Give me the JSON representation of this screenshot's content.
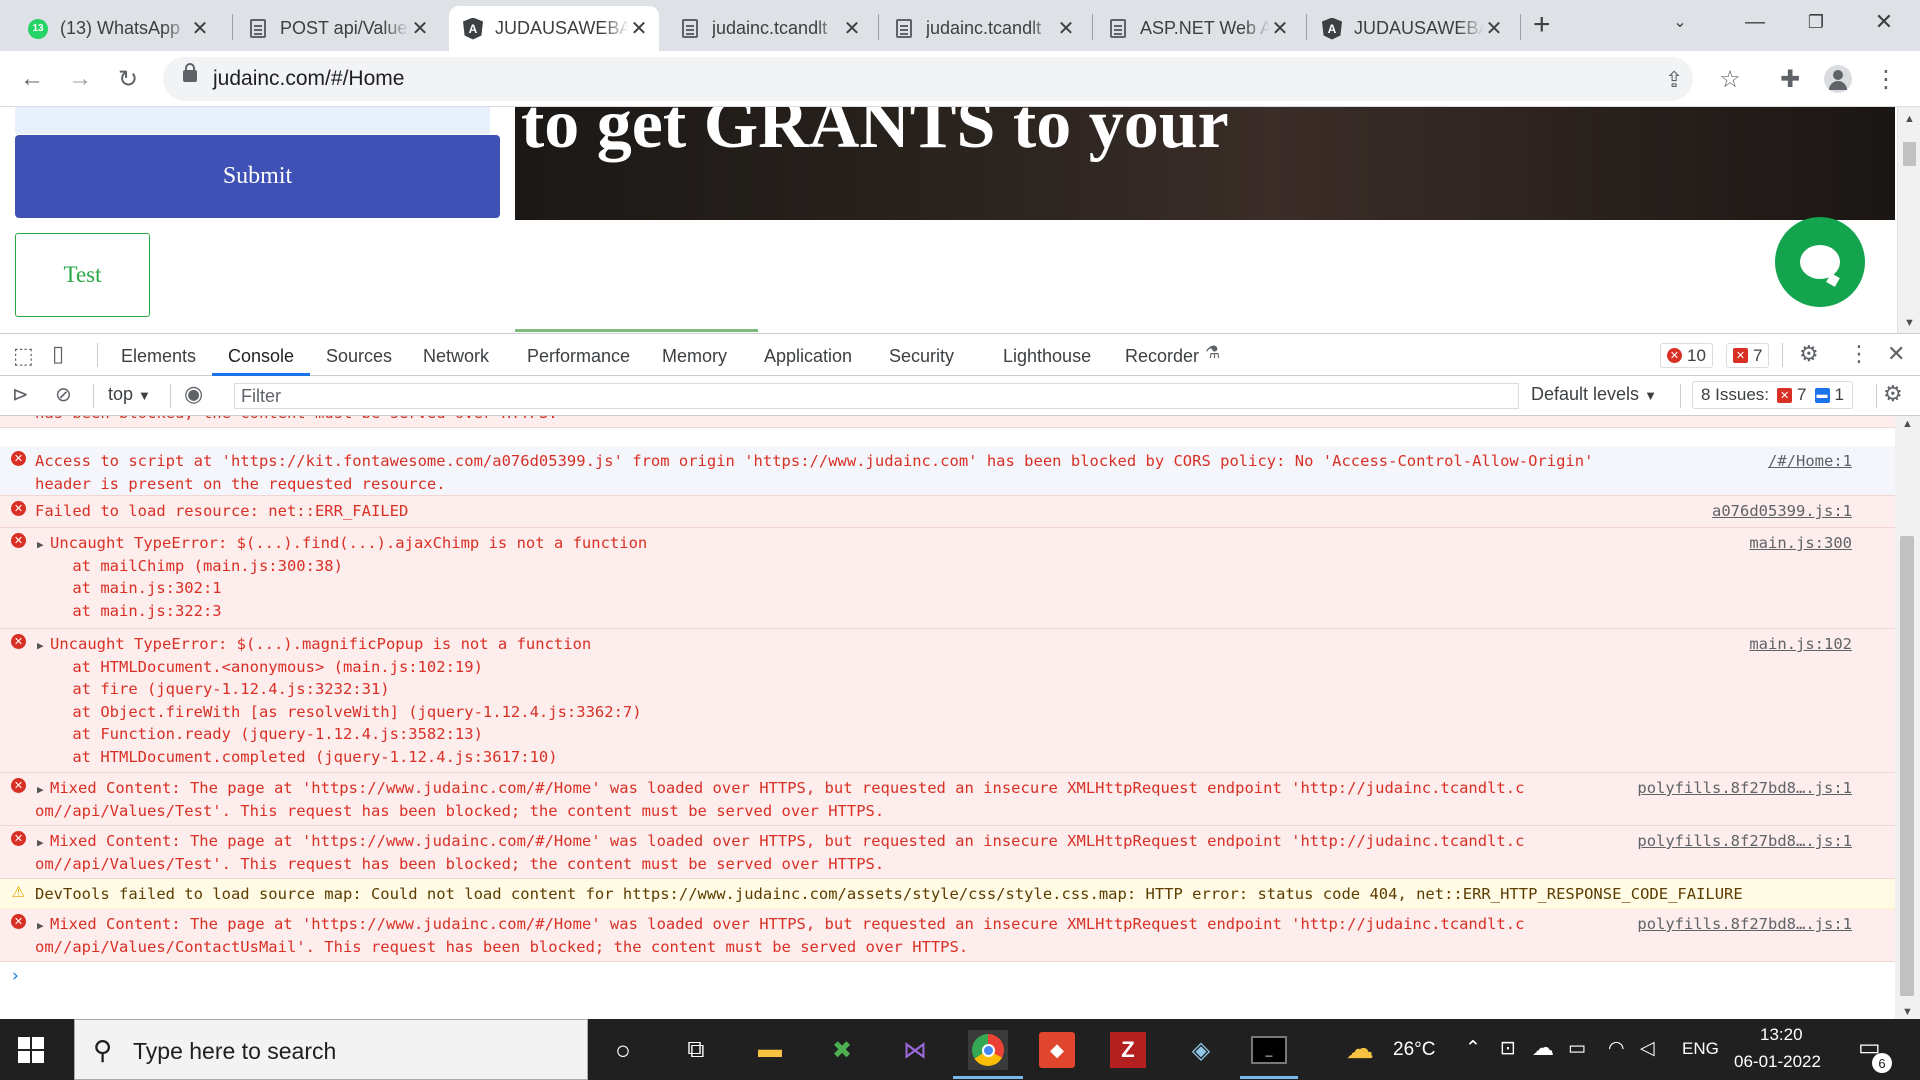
{
  "tabs": [
    {
      "title": "(13) WhatsApp",
      "icon": "whatsapp-icon",
      "badge": "13"
    },
    {
      "title": "POST api/Values",
      "icon": "document-icon"
    },
    {
      "title": "JUDAUSAWEBAPP",
      "icon": "angular-icon",
      "active": true
    },
    {
      "title": "judainc.tcandlt",
      "icon": "document-icon"
    },
    {
      "title": "judainc.tcandlt",
      "icon": "document-icon"
    },
    {
      "title": "ASP.NET Web API",
      "icon": "document-icon"
    },
    {
      "title": "JUDAUSAWEBAPP",
      "icon": "angular-icon"
    }
  ],
  "address_bar": {
    "url": "judainc.com/#/Home"
  },
  "page": {
    "submit_label": "Submit",
    "test_label": "Test",
    "hero_text": "to get GRANTS to your"
  },
  "devtools": {
    "tabs": [
      "Elements",
      "Console",
      "Sources",
      "Network",
      "Performance",
      "Memory",
      "Application",
      "Security",
      "Lighthouse",
      "Recorder"
    ],
    "active_tab": "Console",
    "error_count": "10",
    "issue_count": "7",
    "context": "top",
    "filter_placeholder": "Filter",
    "levels": "Default levels",
    "issues_label": "8 Issues:",
    "issues_errors": "7",
    "issues_info": "1"
  },
  "console": {
    "messages": [
      {
        "level": "error",
        "lines": [
          "has been blocked; the content must be served over HTTPS."
        ],
        "source": "",
        "partial": true
      },
      {
        "level": "error",
        "lines": [
          "Access to script at 'https://kit.fontawesome.com/a076d05399.js' from origin 'https://www.judainc.com' has been blocked by CORS policy: No 'Access-Control-Allow-Origin'",
          "header is present on the requested resource."
        ],
        "source": "/#/Home:1"
      },
      {
        "level": "error",
        "lines": [
          "Failed to load resource: net::ERR_FAILED"
        ],
        "source": "a076d05399.js:1"
      },
      {
        "level": "error",
        "lines": [
          "Uncaught TypeError: $(...).find(...).ajaxChimp is not a function",
          "    at mailChimp (main.js:300:38)",
          "    at main.js:302:1",
          "    at main.js:322:3"
        ],
        "source": "main.js:300",
        "expandable": true
      },
      {
        "level": "error",
        "lines": [
          "Uncaught TypeError: $(...).magnificPopup is not a function",
          "    at HTMLDocument.<anonymous> (main.js:102:19)",
          "    at fire (jquery-1.12.4.js:3232:31)",
          "    at Object.fireWith [as resolveWith] (jquery-1.12.4.js:3362:7)",
          "    at Function.ready (jquery-1.12.4.js:3582:13)",
          "    at HTMLDocument.completed (jquery-1.12.4.js:3617:10)"
        ],
        "source": "main.js:102",
        "expandable": true
      },
      {
        "level": "error",
        "lines": [
          "Mixed Content: The page at 'https://www.judainc.com/#/Home' was loaded over HTTPS, but requested an insecure XMLHttpRequest endpoint 'http://judainc.tcandlt.c",
          "om//api/Values/Test'. This request has been blocked; the content must be served over HTTPS."
        ],
        "source": "polyfills.8f27bd8….js:1",
        "expandable": true
      },
      {
        "level": "error",
        "lines": [
          "Mixed Content: The page at 'https://www.judainc.com/#/Home' was loaded over HTTPS, but requested an insecure XMLHttpRequest endpoint 'http://judainc.tcandlt.c",
          "om//api/Values/Test'. This request has been blocked; the content must be served over HTTPS."
        ],
        "source": "polyfills.8f27bd8….js:1",
        "expandable": true
      },
      {
        "level": "warning",
        "lines": [
          "DevTools failed to load source map: Could not load content for https://www.judainc.com/assets/style/css/style.css.map: HTTP error: status code 404, net::ERR_HTTP_RESPONSE_CODE_FAILURE"
        ],
        "source": ""
      },
      {
        "level": "error",
        "lines": [
          "Mixed Content: The page at 'https://www.judainc.com/#/Home' was loaded over HTTPS, but requested an insecure XMLHttpRequest endpoint 'http://judainc.tcandlt.c",
          "om//api/Values/ContactUsMail'. This request has been blocked; the content must be served over HTTPS."
        ],
        "source": "polyfills.8f27bd8….js:1",
        "expandable": true
      }
    ],
    "prompt": "›"
  },
  "taskbar": {
    "search_placeholder": "Type here to search",
    "weather": "26°C",
    "language": "ENG",
    "time": "13:20",
    "date": "06-01-2022",
    "notifications": "6"
  }
}
